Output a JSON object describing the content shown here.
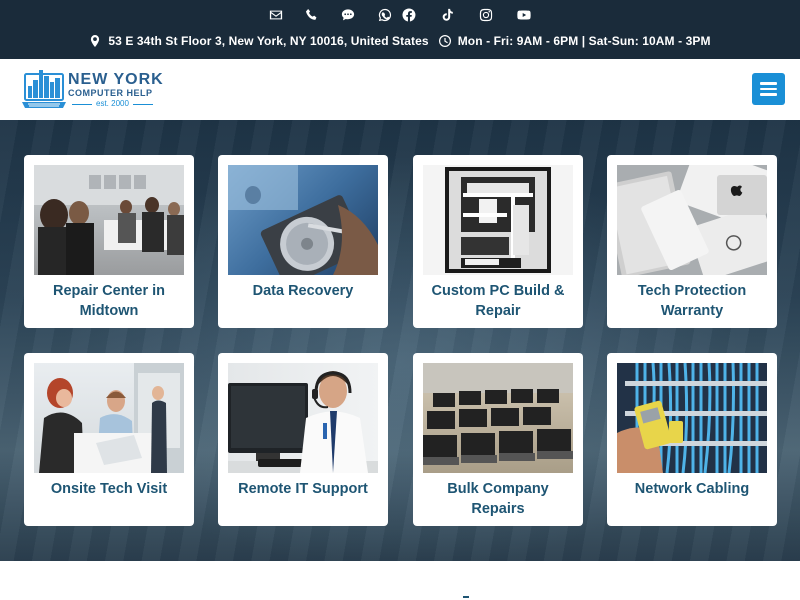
{
  "topbar": {
    "social_icons": [
      "email-icon",
      "phone-icon",
      "sms-icon",
      "whatsapp-icon",
      "facebook-icon",
      "tiktok-icon",
      "instagram-icon",
      "youtube-icon"
    ],
    "address": "53 E 34th St Floor 3, New York, NY 10016, United States",
    "hours": "Mon - Fri: 9AM - 6PM | Sat-Sun: 10AM - 3PM"
  },
  "header": {
    "logo_line1": "NEW YORK",
    "logo_line2": "COMPUTER HELP",
    "logo_line3": "est. 2000",
    "menu_icon": "hamburger-menu-icon"
  },
  "colors": {
    "topbar_bg": "#1a2b3a",
    "accent": "#1a8fd6",
    "card_title": "#1e5573"
  },
  "services": [
    {
      "title": "Repair Center in Midtown",
      "image": "repair-center-photo"
    },
    {
      "title": "Data Recovery",
      "image": "hard-drive-photo"
    },
    {
      "title": "Custom PC Build & Repair",
      "image": "custom-pc-photo"
    },
    {
      "title": "Tech Protection Warranty",
      "image": "laptops-photo"
    },
    {
      "title": "Onsite Tech Visit",
      "image": "office-team-photo"
    },
    {
      "title": "Remote IT Support",
      "image": "support-agent-photo"
    },
    {
      "title": "Bulk Company Repairs",
      "image": "bulk-laptops-photo"
    },
    {
      "title": "Network Cabling",
      "image": "network-cabling-photo"
    }
  ]
}
